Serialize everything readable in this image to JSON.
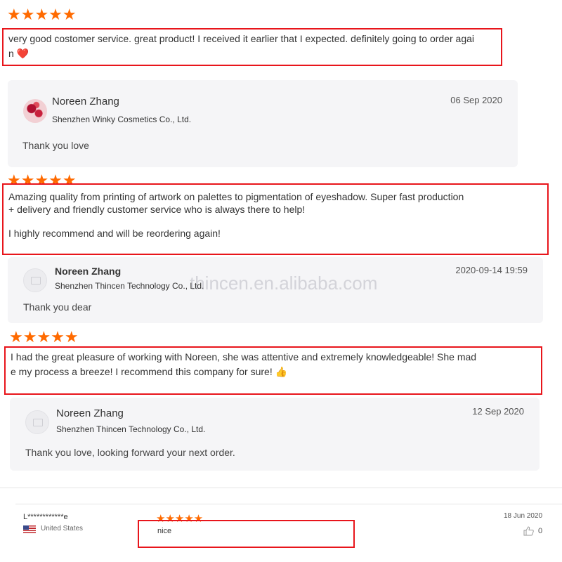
{
  "reviews": [
    {
      "rating": 5,
      "stars": "★★★★★",
      "text_lines": [
        "very good costomer service. great product! I received it earlier that I expected. definitely going to order agai",
        "n ❤️"
      ],
      "reply": {
        "name": "Noreen Zhang",
        "company": "Shenzhen Winky Cosmetics Co., Ltd.",
        "date": "06 Sep 2020",
        "text": "Thank you love"
      }
    },
    {
      "rating": 5,
      "stars": "★★★★★",
      "text_lines": [
        "Amazing quality from printing of artwork on palettes to pigmentation of eyeshadow. Super fast production",
        "+ delivery and friendly customer service who is always there to help!",
        "",
        "I highly recommend and will be reordering again!"
      ],
      "reply": {
        "name": "Noreen Zhang",
        "company": "Shenzhen Thincen Technology Co., Ltd.",
        "date": "2020-09-14 19:59",
        "text": "Thank you dear"
      }
    },
    {
      "rating": 5,
      "stars": "★★★★★",
      "text_lines": [
        "I had the great pleasure of working with Noreen, she was attentive and extremely knowledgeable! She mad",
        "e my process a breeze! I recommend this company for sure! 👍"
      ],
      "reply": {
        "name": "Noreen Zhang",
        "company": "Shenzhen Thincen Technology Co., Ltd.",
        "date": "12 Sep 2020",
        "text": "Thank you love, looking forward your next order."
      }
    }
  ],
  "watermark": "thincen.en.alibaba.com",
  "last_review": {
    "reviewer": "L************e",
    "country": "United States",
    "rating": 5,
    "stars": "★★★★★",
    "text": "nice",
    "date": "18 Jun 2020",
    "likes": "0",
    "like_icon": "thumbs-up-icon"
  },
  "colors": {
    "star": "#ff6a00",
    "highlight_box": "#e8151b",
    "reply_bg": "#f5f5f7"
  }
}
